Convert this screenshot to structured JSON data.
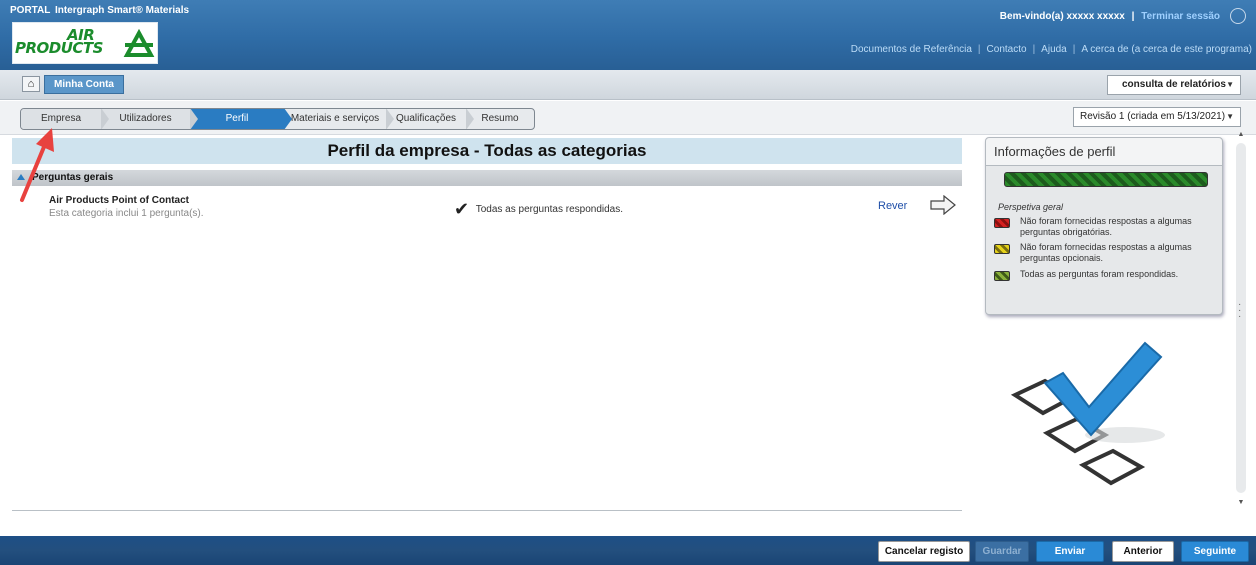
{
  "header": {
    "portal_label": "PORTAL",
    "product_name": "Intergraph Smart® Materials",
    "logo_text_line1": "AIR",
    "logo_text_line2": "PRODUCTS",
    "welcome": "Bem-vindo(a) xxxxx xxxxx",
    "separator": "|",
    "logout": "Terminar sessão",
    "links": [
      "Documentos de Referência",
      "Contacto",
      "Ajuda",
      "A cerca de (a cerca de este programa)"
    ]
  },
  "accountbar": {
    "account_tab": "Minha Conta",
    "report_select": "consulta de relatórios"
  },
  "workflow": {
    "steps": [
      "Empresa",
      "Utilizadores",
      "Perfil",
      "Materiais e serviços",
      "Qualificações",
      "Resumo"
    ],
    "active_index": 2,
    "revision": "Revisão 1 (criada em 5/13/2021)"
  },
  "main": {
    "title": "Perfil da empresa - Todas as categorias",
    "section_title": "Perguntas gerais",
    "category_title": "Air Products Point of Contact",
    "category_desc": "Esta categoria inclui 1 pergunta(s).",
    "status": "Todas as perguntas respondidas.",
    "review_link": "Rever"
  },
  "info_panel": {
    "title": "Informações de perfil",
    "overall_label": "Perspetiva geral",
    "legend": [
      {
        "text": "Não foram fornecidas respostas a algumas perguntas obrigatórias.",
        "color": "#d42020"
      },
      {
        "text": "Não foram fornecidas respostas a algumas perguntas opcionais.",
        "color": "#e6d21a"
      },
      {
        "text": "Todas as perguntas foram respondidas.",
        "color": "#8ab03a"
      }
    ]
  },
  "buttons": {
    "cancel": "Cancelar registo",
    "save": "Guardar",
    "send": "Enviar",
    "previous": "Anterior",
    "next": "Seguinte"
  },
  "colors": {
    "header_blue": "#2f6ca6",
    "active_step": "#2a7cc2",
    "title_band": "#cfe3ee",
    "progress_green": "#2a8a2a",
    "annotation_red": "#e8423f"
  }
}
